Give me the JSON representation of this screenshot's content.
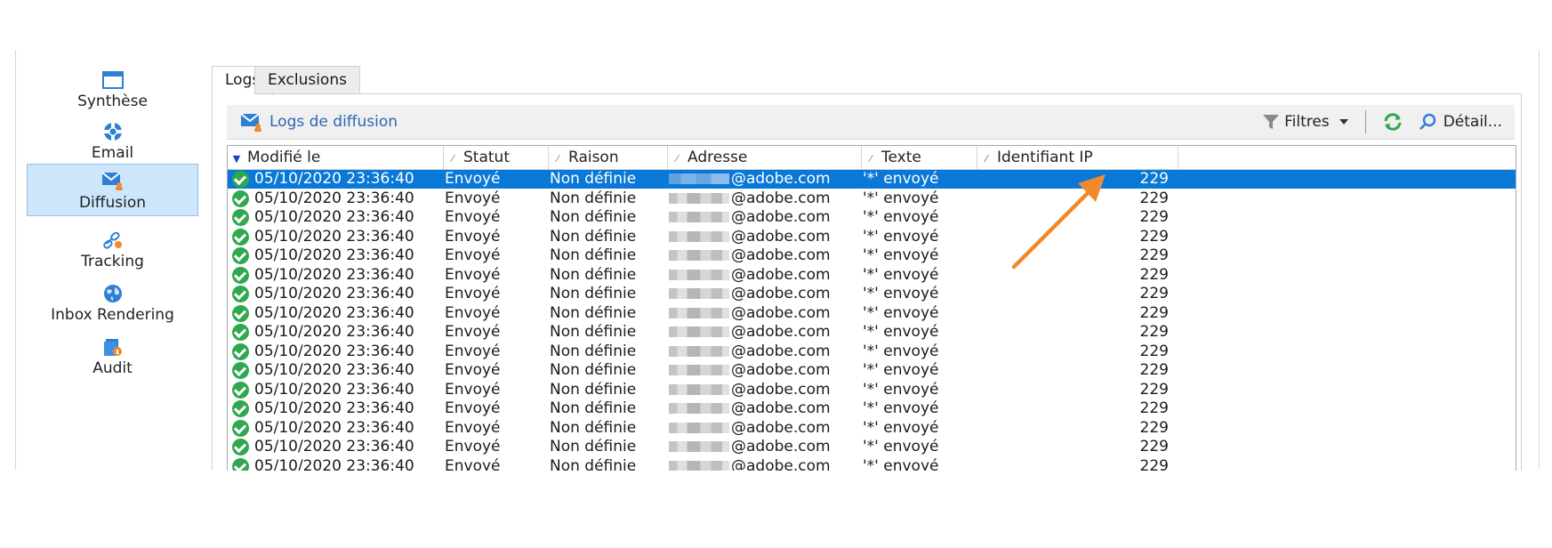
{
  "nav": {
    "items": [
      {
        "label": "Synthèse",
        "icon": "window-icon",
        "active": false
      },
      {
        "label": "Email",
        "icon": "email-icon",
        "active": false
      },
      {
        "label": "Diffusion",
        "icon": "diffusion-icon",
        "active": true
      },
      {
        "label": "Tracking",
        "icon": "tracking-icon",
        "active": false
      },
      {
        "label": "Inbox Rendering",
        "icon": "globe-icon",
        "active": false
      },
      {
        "label": "Audit",
        "icon": "audit-icon",
        "active": false
      }
    ]
  },
  "tabs": [
    {
      "label": "Logs",
      "active": true
    },
    {
      "label": "Exclusions",
      "active": false
    }
  ],
  "toolbar": {
    "title": "Logs de diffusion",
    "filters_label": "Filtres",
    "detail_label": "Détail..."
  },
  "columns": [
    {
      "label": "Modifié le"
    },
    {
      "label": "Statut"
    },
    {
      "label": "Raison"
    },
    {
      "label": "Adresse"
    },
    {
      "label": "Texte"
    },
    {
      "label": "Identifiant IP"
    }
  ],
  "rows": [
    {
      "date": "05/10/2020 23:36:40",
      "status": "Envoyé",
      "reason": "Non définie",
      "address": "@adobe.com",
      "text": "'*' envoyé",
      "ip": "229"
    },
    {
      "date": "05/10/2020 23:36:40",
      "status": "Envoyé",
      "reason": "Non définie",
      "address": "@adobe.com",
      "text": "'*' envoyé",
      "ip": "229"
    },
    {
      "date": "05/10/2020 23:36:40",
      "status": "Envoyé",
      "reason": "Non définie",
      "address": "@adobe.com",
      "text": "'*' envoyé",
      "ip": "229"
    },
    {
      "date": "05/10/2020 23:36:40",
      "status": "Envoyé",
      "reason": "Non définie",
      "address": "@adobe.com",
      "text": "'*' envoyé",
      "ip": "229"
    },
    {
      "date": "05/10/2020 23:36:40",
      "status": "Envoyé",
      "reason": "Non définie",
      "address": "@adobe.com",
      "text": "'*' envoyé",
      "ip": "229"
    },
    {
      "date": "05/10/2020 23:36:40",
      "status": "Envoyé",
      "reason": "Non définie",
      "address": "@adobe.com",
      "text": "'*' envoyé",
      "ip": "229"
    },
    {
      "date": "05/10/2020 23:36:40",
      "status": "Envoyé",
      "reason": "Non définie",
      "address": "@adobe.com",
      "text": "'*' envoyé",
      "ip": "229"
    },
    {
      "date": "05/10/2020 23:36:40",
      "status": "Envoyé",
      "reason": "Non définie",
      "address": "@adobe.com",
      "text": "'*' envoyé",
      "ip": "229"
    },
    {
      "date": "05/10/2020 23:36:40",
      "status": "Envoyé",
      "reason": "Non définie",
      "address": "@adobe.com",
      "text": "'*' envoyé",
      "ip": "229"
    },
    {
      "date": "05/10/2020 23:36:40",
      "status": "Envoyé",
      "reason": "Non définie",
      "address": "@adobe.com",
      "text": "'*' envoyé",
      "ip": "229"
    },
    {
      "date": "05/10/2020 23:36:40",
      "status": "Envoyé",
      "reason": "Non définie",
      "address": "@adobe.com",
      "text": "'*' envoyé",
      "ip": "229"
    },
    {
      "date": "05/10/2020 23:36:40",
      "status": "Envoyé",
      "reason": "Non définie",
      "address": "@adobe.com",
      "text": "'*' envoyé",
      "ip": "229"
    },
    {
      "date": "05/10/2020 23:36:40",
      "status": "Envoyé",
      "reason": "Non définie",
      "address": "@adobe.com",
      "text": "'*' envoyé",
      "ip": "229"
    },
    {
      "date": "05/10/2020 23:36:40",
      "status": "Envoyé",
      "reason": "Non définie",
      "address": "@adobe.com",
      "text": "'*' envoyé",
      "ip": "229"
    },
    {
      "date": "05/10/2020 23:36:40",
      "status": "Envoyé",
      "reason": "Non définie",
      "address": "@adobe.com",
      "text": "'*' envoyé",
      "ip": "229"
    },
    {
      "date": "05/10/2020 23:36:40",
      "status": "Envoyé",
      "reason": "Non définie",
      "address": "@adobe.com",
      "text": "'*' envoyé",
      "ip": "229"
    }
  ],
  "colors": {
    "selection": "#0a78d7",
    "accent": "#2b67b4",
    "arrow": "#f08a2c",
    "nav_active": "#cde6fb"
  }
}
